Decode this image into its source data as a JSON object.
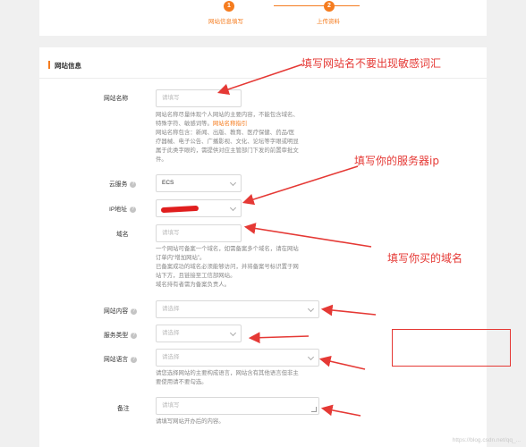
{
  "steps": [
    {
      "number": "1",
      "label": "网站信息填写"
    },
    {
      "number": "2",
      "label": "上传资料"
    }
  ],
  "section": {
    "title": "网站信息"
  },
  "form": {
    "site_name": {
      "label": "网站名称",
      "placeholder": "请填写",
      "desc_line1": "网站名称尽量体现个人网站的主要内容，不能包含域名、",
      "desc_line2_pre": "特殊字符、敏感词等。",
      "desc_link": "网站名称指引",
      "desc_line3": "网站名称包含：新闻、出版、教育、医疗保健、药品/医",
      "desc_line4": "疗器械、电子公告、广播影视、文化、论坛等字眼或明显",
      "desc_line5": "属于此类字眼的，需提供对应主管部门下发的前置审批文",
      "desc_line6": "件。"
    },
    "cloud_service": {
      "label": "云服务",
      "value": "ECS"
    },
    "ip": {
      "label": "IP地址"
    },
    "domain": {
      "label": "域名",
      "placeholder": "请填写",
      "desc_line1": "一个网站可备案一个域名，如需备案多个域名，请在网站",
      "desc_line2": "订单内“增加网站”。",
      "desc_line3": "已备案成功的域名必须能够访问，并将备案号标识置于网",
      "desc_line4": "站下方，且链接至工信部网站。",
      "desc_line5": "域名持有者需为备案负责人。"
    },
    "site_content": {
      "label": "网站内容",
      "placeholder": "请选择"
    },
    "service_type": {
      "label": "服务类型",
      "placeholder": "请选择"
    },
    "site_language": {
      "label": "网站语言",
      "placeholder": "请选择",
      "desc_line1": "请您选择网站的主要构成语言，网站含有其他语言但非主",
      "desc_line2": "要使用请不要勾选。"
    },
    "remarks": {
      "label": "备注",
      "placeholder": "请填写",
      "desc": "请填写网站开办后的内容。"
    }
  },
  "annotations": {
    "site_name_note": "填写网站名不要出现敏感词汇",
    "ip_note": "填写你的服务器ip",
    "domain_note": "填写你买的域名"
  },
  "watermark": "https://blog.csdn.net/qq_..."
}
